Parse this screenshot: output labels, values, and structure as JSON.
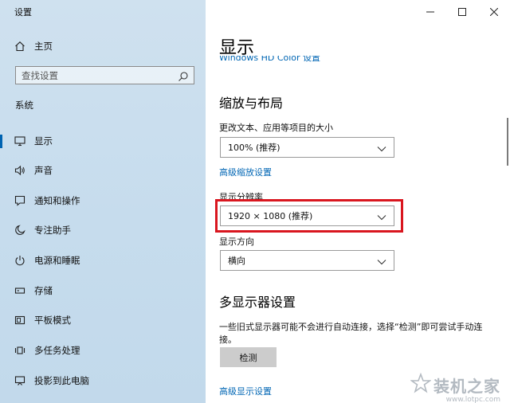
{
  "window": {
    "title": "设置"
  },
  "sidebar": {
    "home_label": "主页",
    "search_placeholder": "查找设置",
    "section_label": "系统",
    "items": [
      {
        "label": "显示",
        "icon": "monitor-icon",
        "active": true
      },
      {
        "label": "声音",
        "icon": "speaker-icon"
      },
      {
        "label": "通知和操作",
        "icon": "notification-icon"
      },
      {
        "label": "专注助手",
        "icon": "moon-icon"
      },
      {
        "label": "电源和睡眠",
        "icon": "power-icon"
      },
      {
        "label": "存储",
        "icon": "storage-icon"
      },
      {
        "label": "平板模式",
        "icon": "tablet-icon"
      },
      {
        "label": "多任务处理",
        "icon": "multitask-icon"
      },
      {
        "label": "投影到此电脑",
        "icon": "project-icon"
      }
    ]
  },
  "main": {
    "title": "显示",
    "cut_link": "Windows HD Color 设置",
    "scale_section": {
      "heading": "缩放与布局",
      "scale_label": "更改文本、应用等项目的大小",
      "scale_value": "100% (推荐)",
      "advanced_scale_link": "高级缩放设置",
      "resolution_label": "显示分辨率",
      "resolution_value": "1920 × 1080 (推荐)",
      "orientation_label": "显示方向",
      "orientation_value": "横向"
    },
    "multi_section": {
      "heading": "多显示器设置",
      "description": "一些旧式显示器可能不会进行自动连接，选择“检测”即可尝试手动连接。",
      "detect_button": "检测",
      "advanced_display_link": "高级显示设置"
    }
  },
  "watermark": {
    "text": "装机之家",
    "url": "www.lotpc.com"
  },
  "colors": {
    "accent": "#0063b1",
    "link": "#0066b4",
    "highlight": "#d9161f",
    "sidebar_bg": "#c8ddee"
  }
}
